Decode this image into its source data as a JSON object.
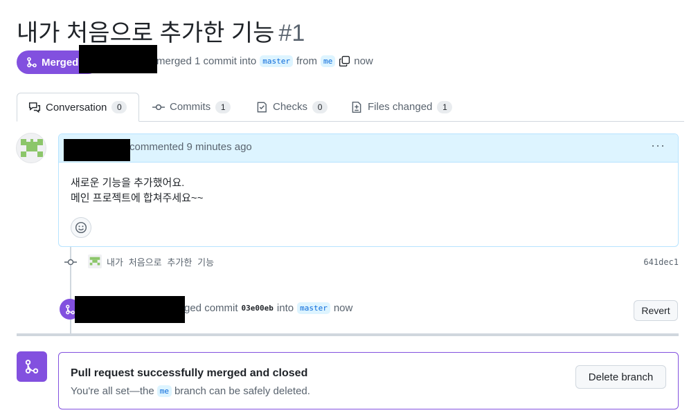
{
  "pull_request": {
    "title": "내가 처음으로 추가한 기능",
    "number": "#1",
    "state_label": "Merged",
    "merge_summary": {
      "action": "merged 1 commit into",
      "base_branch": "master",
      "from_label": "from",
      "head_branch": "me",
      "time": "now"
    }
  },
  "tabs": [
    {
      "label": "Conversation",
      "count": "0",
      "icon": "conversation-icon"
    },
    {
      "label": "Commits",
      "count": "1",
      "icon": "commit-icon"
    },
    {
      "label": "Checks",
      "count": "0",
      "icon": "checks-icon"
    },
    {
      "label": "Files changed",
      "count": "1",
      "icon": "file-diff-icon"
    }
  ],
  "comment": {
    "meta": "commented 9 minutes ago",
    "menu": "···",
    "body_lines": [
      "새로운 기능을 추가했어요.",
      "메인 프로젝트에 합쳐주세요~~"
    ],
    "reaction_icon": "smiley-icon"
  },
  "timeline": {
    "commit": {
      "message": "내가 처음으로 추가한 기능",
      "sha": "641dec1"
    },
    "merge_event": {
      "text_prefix": "ged commit",
      "commit_sha": "03e00eb",
      "into_label": "into",
      "branch": "master",
      "time": "now",
      "revert_label": "Revert"
    }
  },
  "merged_box": {
    "title": "Pull request successfully merged and closed",
    "sub_prefix": "You're all set—the",
    "branch": "me",
    "sub_suffix": "branch can be safely deleted.",
    "delete_label": "Delete branch"
  },
  "colors": {
    "merged_purple": "#8250df",
    "link_blue": "#0969da",
    "comment_header_bg": "#ddf4ff"
  }
}
